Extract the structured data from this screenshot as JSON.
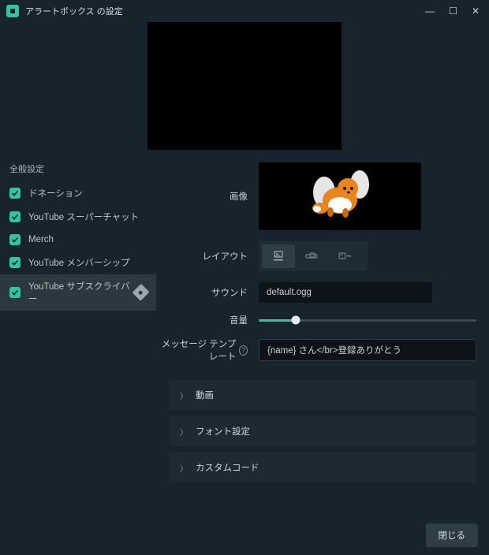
{
  "window": {
    "title": "アラートボックス の設定"
  },
  "sidebar": {
    "header": "全般設定",
    "items": [
      {
        "label": "ドネーション"
      },
      {
        "label": "YouTube スーパーチャット"
      },
      {
        "label": "Merch"
      },
      {
        "label": "YouTube メンバーシップ"
      },
      {
        "label": "YouTube サブスクライバー"
      }
    ]
  },
  "labels": {
    "image": "画像",
    "layout": "レイアウト",
    "sound": "サウンド",
    "volume": "音量",
    "message_template": "メッセージ テンプレート"
  },
  "values": {
    "sound": "default.ogg",
    "volume_percent": 17,
    "message_template": "{name} さん</br>登録ありがとう"
  },
  "accordions": [
    {
      "label": "動画"
    },
    {
      "label": "フォント設定"
    },
    {
      "label": "カスタムコード"
    }
  ],
  "buttons": {
    "close": "閉じる"
  }
}
